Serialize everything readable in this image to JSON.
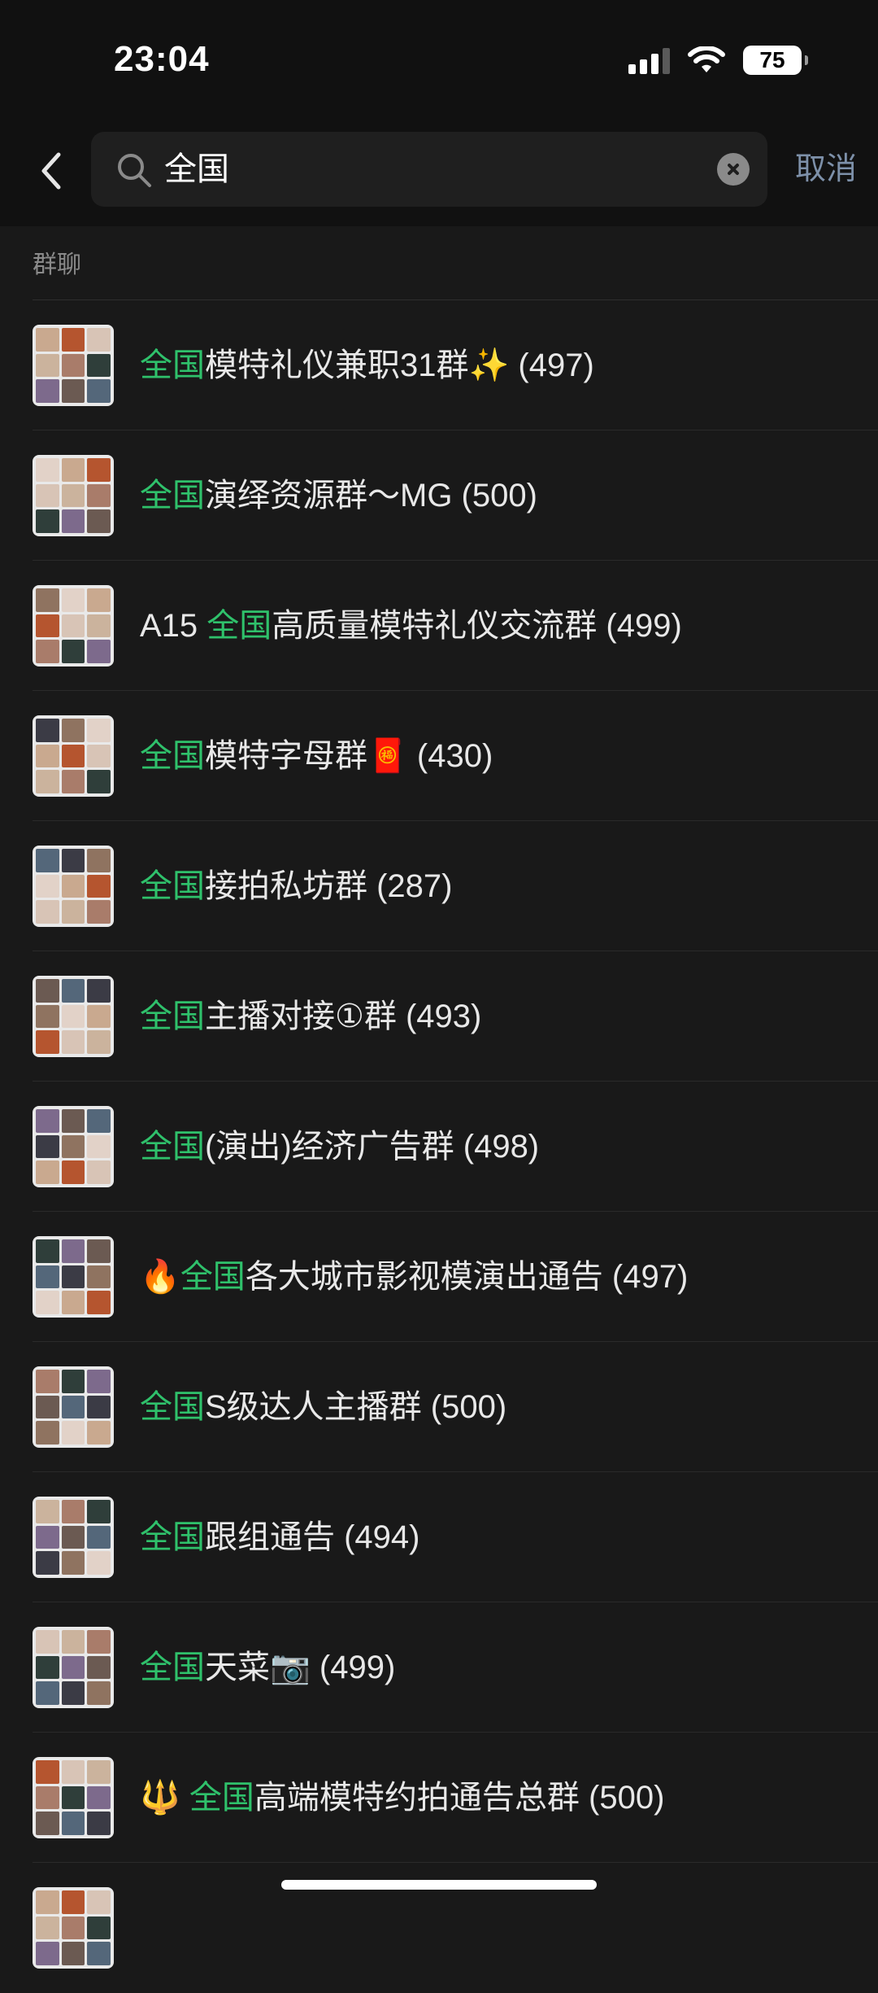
{
  "status": {
    "time": "23:04",
    "battery": "75"
  },
  "search": {
    "query": "全国",
    "cancel_label": "取消"
  },
  "section_label": "群聊",
  "colors": {
    "highlight": "#2fc16b",
    "background": "#191919"
  },
  "results": [
    {
      "prefix": "",
      "highlight": "全国",
      "rest": "模特礼仪兼职31群✨ (497)"
    },
    {
      "prefix": "",
      "highlight": "全国",
      "rest": "演绎资源群～MG (500)"
    },
    {
      "prefix": "A15 ",
      "highlight": "全国",
      "rest": "高质量模特礼仪交流群 (499)"
    },
    {
      "prefix": "",
      "highlight": "全国",
      "rest": "模特字母群🧧 (430)"
    },
    {
      "prefix": "",
      "highlight": "全国",
      "rest": "接拍私坊群 (287)"
    },
    {
      "prefix": "",
      "highlight": "全国",
      "rest": "主播对接①群 (493)"
    },
    {
      "prefix": "",
      "highlight": "全国",
      "rest": "(演出)经济广告群 (498)"
    },
    {
      "prefix": "🔥",
      "highlight": "全国",
      "rest": "各大城市影视模演出通告 (497)"
    },
    {
      "prefix": "",
      "highlight": "全国",
      "rest": "S级达人主播群 (500)"
    },
    {
      "prefix": "",
      "highlight": "全国",
      "rest": "跟组通告 (494)"
    },
    {
      "prefix": "",
      "highlight": "全国",
      "rest": "天菜📷 (499)"
    },
    {
      "prefix": "🔱 ",
      "highlight": "全国",
      "rest": "高端模特约拍通告总群 (500)"
    }
  ]
}
